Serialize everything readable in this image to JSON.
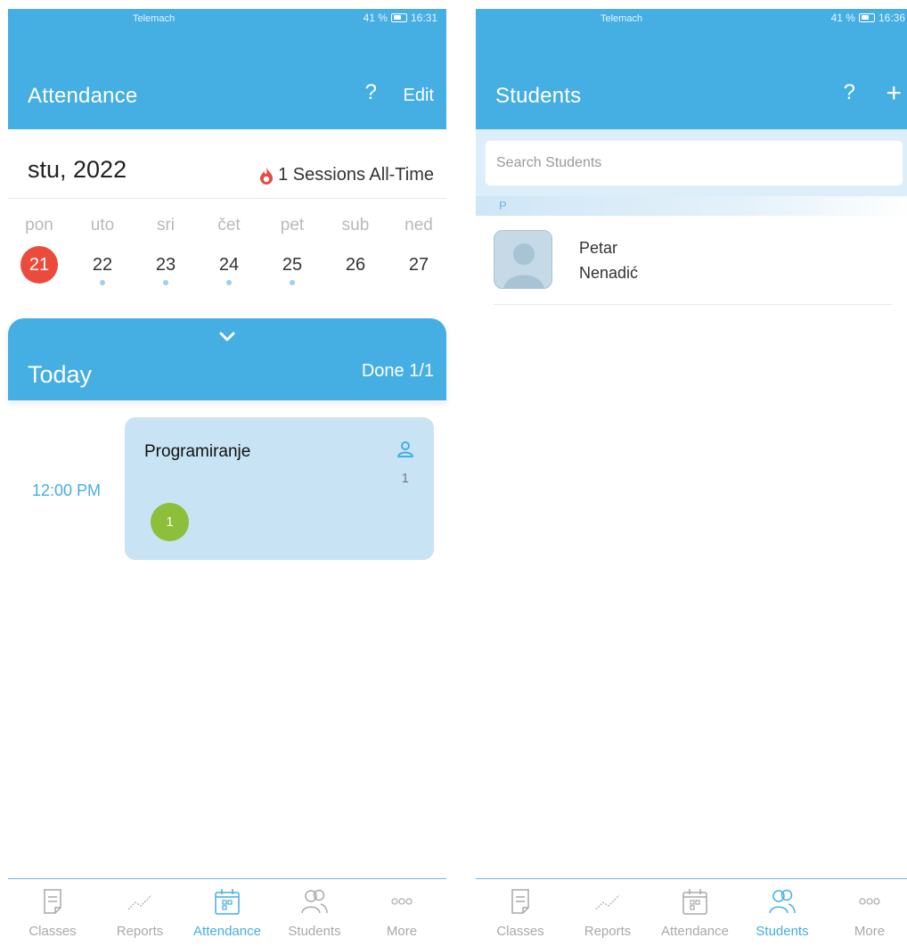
{
  "left": {
    "status": {
      "carrier": "Telemach",
      "battery": "41 %",
      "time": "16:31"
    },
    "header": {
      "title": "Attendance",
      "help": "?",
      "edit": "Edit"
    },
    "calendar": {
      "month": "stu, 2022",
      "sessions": "1 Sessions All-Time",
      "days": [
        {
          "name": "pon",
          "num": "21"
        },
        {
          "name": "uto",
          "num": "22"
        },
        {
          "name": "sri",
          "num": "23"
        },
        {
          "name": "čet",
          "num": "24"
        },
        {
          "name": "pet",
          "num": "25"
        },
        {
          "name": "sub",
          "num": "26"
        },
        {
          "name": "ned",
          "num": "27"
        }
      ]
    },
    "today": {
      "label": "Today",
      "done": "Done 1/1"
    },
    "session": {
      "time": "12:00 PM",
      "name": "Programiranje",
      "count": "1",
      "badge": "1"
    }
  },
  "right": {
    "status": {
      "carrier": "Telemach",
      "battery": "41 %",
      "time": "16:36"
    },
    "header": {
      "title": "Students",
      "help": "?",
      "add": "+"
    },
    "search": {
      "placeholder": "Search Students"
    },
    "section": "P",
    "student": {
      "first": "Petar",
      "last": "Nenadić"
    }
  },
  "tabs": [
    "Classes",
    "Reports",
    "Attendance",
    "Students",
    "More"
  ],
  "colors": {
    "primary": "#45aee3",
    "today": "#ea4b3c",
    "badge": "#8dbf3b",
    "card": "#c8e3f4"
  }
}
